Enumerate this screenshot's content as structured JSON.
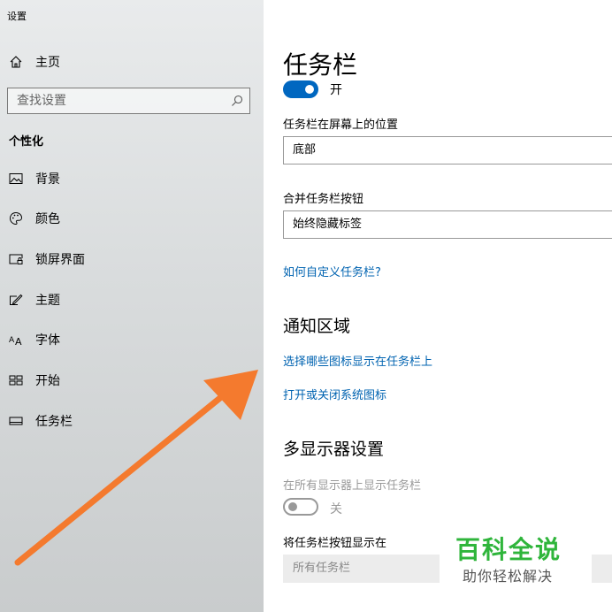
{
  "app": {
    "title": "设置"
  },
  "sidebar": {
    "home_label": "主页",
    "search_placeholder": "查找设置",
    "section_title": "个性化",
    "items": [
      {
        "label": "背景",
        "icon": "picture-icon"
      },
      {
        "label": "颜色",
        "icon": "palette-icon"
      },
      {
        "label": "锁屏界面",
        "icon": "lock-screen-icon"
      },
      {
        "label": "主题",
        "icon": "theme-icon"
      },
      {
        "label": "字体",
        "icon": "font-icon"
      },
      {
        "label": "开始",
        "icon": "start-icon"
      },
      {
        "label": "任务栏",
        "icon": "taskbar-icon"
      }
    ]
  },
  "main": {
    "title": "任务栏",
    "lock_toggle_state": "开",
    "position_label": "任务栏在屏幕上的位置",
    "position_value": "底部",
    "combine_label": "合并任务栏按钮",
    "combine_value": "始终隐藏标签",
    "customize_link": "如何自定义任务栏?",
    "notification_heading": "通知区域",
    "notification_link1": "选择哪些图标显示在任务栏上",
    "notification_link2": "打开或关闭系统图标",
    "multi_heading": "多显示器设置",
    "multi_show_label": "在所有显示器上显示任务栏",
    "multi_toggle_state": "关",
    "multi_buttons_label": "将任务栏按钮显示在",
    "multi_buttons_value": "所有任务栏"
  },
  "watermark": {
    "title": "百科全说",
    "subtitle": "助你轻松解决"
  },
  "colors": {
    "accent": "#0067c0",
    "link": "#0063b1",
    "arrow": "#f47a2e",
    "watermark": "#2fb53b"
  }
}
